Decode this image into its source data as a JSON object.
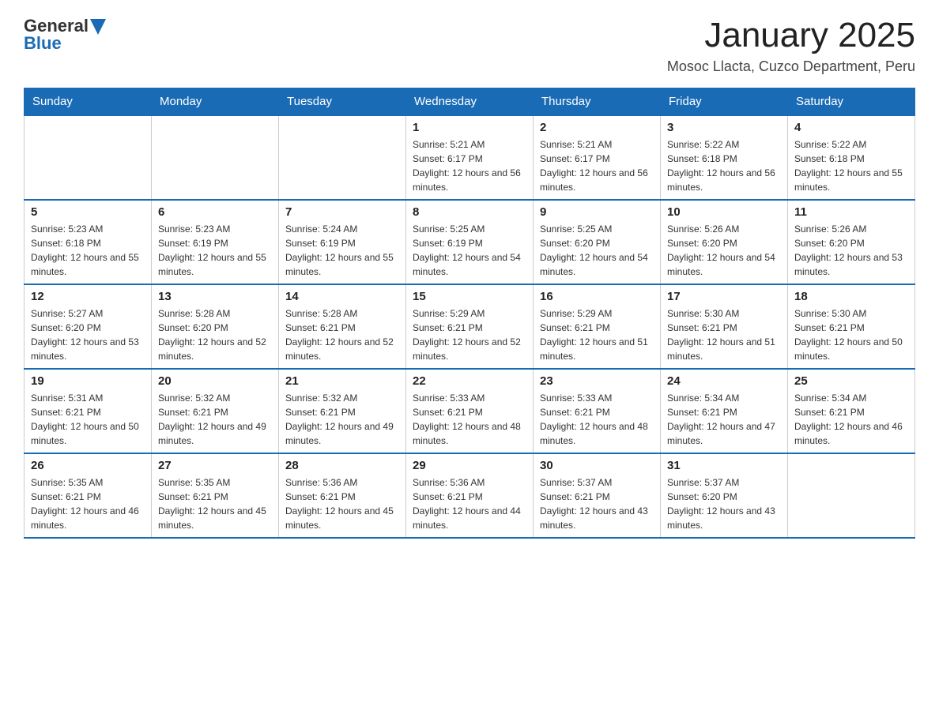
{
  "logo": {
    "general": "General",
    "blue": "Blue"
  },
  "title": "January 2025",
  "subtitle": "Mosoc Llacta, Cuzco Department, Peru",
  "days_of_week": [
    "Sunday",
    "Monday",
    "Tuesday",
    "Wednesday",
    "Thursday",
    "Friday",
    "Saturday"
  ],
  "weeks": [
    [
      {
        "day": "",
        "info": ""
      },
      {
        "day": "",
        "info": ""
      },
      {
        "day": "",
        "info": ""
      },
      {
        "day": "1",
        "info": "Sunrise: 5:21 AM\nSunset: 6:17 PM\nDaylight: 12 hours and 56 minutes."
      },
      {
        "day": "2",
        "info": "Sunrise: 5:21 AM\nSunset: 6:17 PM\nDaylight: 12 hours and 56 minutes."
      },
      {
        "day": "3",
        "info": "Sunrise: 5:22 AM\nSunset: 6:18 PM\nDaylight: 12 hours and 56 minutes."
      },
      {
        "day": "4",
        "info": "Sunrise: 5:22 AM\nSunset: 6:18 PM\nDaylight: 12 hours and 55 minutes."
      }
    ],
    [
      {
        "day": "5",
        "info": "Sunrise: 5:23 AM\nSunset: 6:18 PM\nDaylight: 12 hours and 55 minutes."
      },
      {
        "day": "6",
        "info": "Sunrise: 5:23 AM\nSunset: 6:19 PM\nDaylight: 12 hours and 55 minutes."
      },
      {
        "day": "7",
        "info": "Sunrise: 5:24 AM\nSunset: 6:19 PM\nDaylight: 12 hours and 55 minutes."
      },
      {
        "day": "8",
        "info": "Sunrise: 5:25 AM\nSunset: 6:19 PM\nDaylight: 12 hours and 54 minutes."
      },
      {
        "day": "9",
        "info": "Sunrise: 5:25 AM\nSunset: 6:20 PM\nDaylight: 12 hours and 54 minutes."
      },
      {
        "day": "10",
        "info": "Sunrise: 5:26 AM\nSunset: 6:20 PM\nDaylight: 12 hours and 54 minutes."
      },
      {
        "day": "11",
        "info": "Sunrise: 5:26 AM\nSunset: 6:20 PM\nDaylight: 12 hours and 53 minutes."
      }
    ],
    [
      {
        "day": "12",
        "info": "Sunrise: 5:27 AM\nSunset: 6:20 PM\nDaylight: 12 hours and 53 minutes."
      },
      {
        "day": "13",
        "info": "Sunrise: 5:28 AM\nSunset: 6:20 PM\nDaylight: 12 hours and 52 minutes."
      },
      {
        "day": "14",
        "info": "Sunrise: 5:28 AM\nSunset: 6:21 PM\nDaylight: 12 hours and 52 minutes."
      },
      {
        "day": "15",
        "info": "Sunrise: 5:29 AM\nSunset: 6:21 PM\nDaylight: 12 hours and 52 minutes."
      },
      {
        "day": "16",
        "info": "Sunrise: 5:29 AM\nSunset: 6:21 PM\nDaylight: 12 hours and 51 minutes."
      },
      {
        "day": "17",
        "info": "Sunrise: 5:30 AM\nSunset: 6:21 PM\nDaylight: 12 hours and 51 minutes."
      },
      {
        "day": "18",
        "info": "Sunrise: 5:30 AM\nSunset: 6:21 PM\nDaylight: 12 hours and 50 minutes."
      }
    ],
    [
      {
        "day": "19",
        "info": "Sunrise: 5:31 AM\nSunset: 6:21 PM\nDaylight: 12 hours and 50 minutes."
      },
      {
        "day": "20",
        "info": "Sunrise: 5:32 AM\nSunset: 6:21 PM\nDaylight: 12 hours and 49 minutes."
      },
      {
        "day": "21",
        "info": "Sunrise: 5:32 AM\nSunset: 6:21 PM\nDaylight: 12 hours and 49 minutes."
      },
      {
        "day": "22",
        "info": "Sunrise: 5:33 AM\nSunset: 6:21 PM\nDaylight: 12 hours and 48 minutes."
      },
      {
        "day": "23",
        "info": "Sunrise: 5:33 AM\nSunset: 6:21 PM\nDaylight: 12 hours and 48 minutes."
      },
      {
        "day": "24",
        "info": "Sunrise: 5:34 AM\nSunset: 6:21 PM\nDaylight: 12 hours and 47 minutes."
      },
      {
        "day": "25",
        "info": "Sunrise: 5:34 AM\nSunset: 6:21 PM\nDaylight: 12 hours and 46 minutes."
      }
    ],
    [
      {
        "day": "26",
        "info": "Sunrise: 5:35 AM\nSunset: 6:21 PM\nDaylight: 12 hours and 46 minutes."
      },
      {
        "day": "27",
        "info": "Sunrise: 5:35 AM\nSunset: 6:21 PM\nDaylight: 12 hours and 45 minutes."
      },
      {
        "day": "28",
        "info": "Sunrise: 5:36 AM\nSunset: 6:21 PM\nDaylight: 12 hours and 45 minutes."
      },
      {
        "day": "29",
        "info": "Sunrise: 5:36 AM\nSunset: 6:21 PM\nDaylight: 12 hours and 44 minutes."
      },
      {
        "day": "30",
        "info": "Sunrise: 5:37 AM\nSunset: 6:21 PM\nDaylight: 12 hours and 43 minutes."
      },
      {
        "day": "31",
        "info": "Sunrise: 5:37 AM\nSunset: 6:20 PM\nDaylight: 12 hours and 43 minutes."
      },
      {
        "day": "",
        "info": ""
      }
    ]
  ]
}
